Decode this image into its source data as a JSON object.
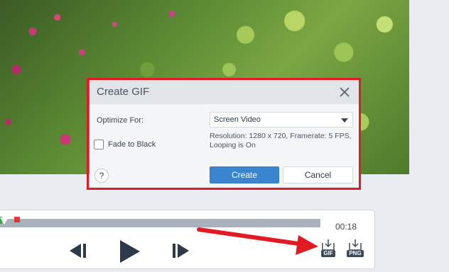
{
  "dialog": {
    "title": "Create GIF",
    "optimize_label": "Optimize For:",
    "optimize_value": "Screen Video",
    "info_line1": "Resolution: 1280 x 720, Framerate: 5 FPS,",
    "info_line2": "Looping is On",
    "fade_label": "Fade to Black",
    "fade_checked": false,
    "help_label": "?",
    "create_label": "Create",
    "cancel_label": "Cancel"
  },
  "player": {
    "time": "00:18",
    "gif_badge": "GIF",
    "png_badge": "PNG"
  },
  "icons": {
    "close": "close-icon",
    "dropdown": "chevron-down-icon",
    "prev": "step-back-icon",
    "play": "play-icon",
    "next": "step-forward-icon",
    "export_gif": "gif-export-icon",
    "export_png": "png-export-icon"
  },
  "colors": {
    "accent": "#3b84cf",
    "highlight": "#e01b24",
    "dialog_header": "#e1e4e8"
  }
}
